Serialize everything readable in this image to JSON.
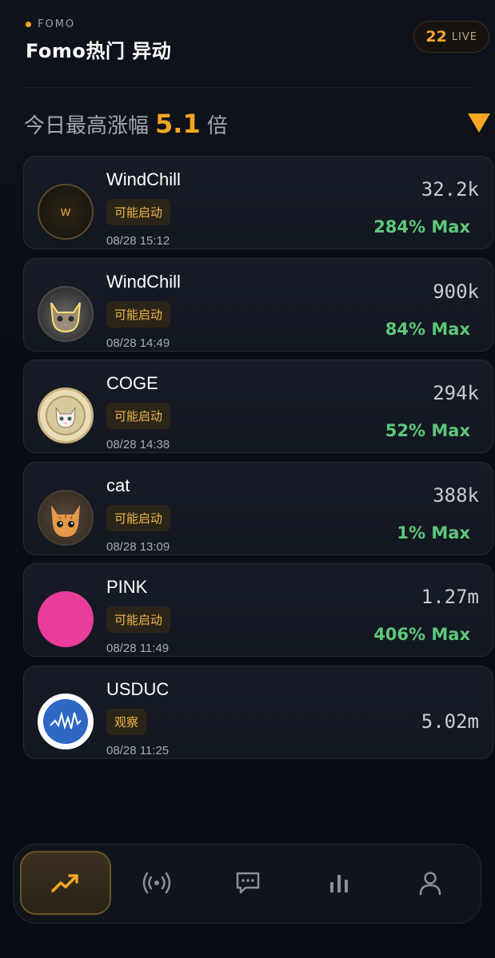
{
  "header": {
    "brand": "FOMO",
    "title": "Fomo热门 异动",
    "live_count": "22",
    "live_label": "LIVE"
  },
  "summary": {
    "prefix": "今日最高涨幅",
    "value": "5.1",
    "suffix": "倍"
  },
  "colors": {
    "accent": "#f5a623",
    "gain": "#5dc77a",
    "background": "#0b0e14",
    "card": "#151a23"
  },
  "tokens": [
    {
      "name": "WindChill",
      "tag": "可能启动",
      "time": "08/28 15:12",
      "value": "32.2k",
      "gain": "284% Max",
      "avatar_icon": "letter-w-coin-icon",
      "avatar_letter": "W"
    },
    {
      "name": "WindChill",
      "tag": "可能启动",
      "time": "08/28 14:49",
      "value": "900k",
      "gain": "84% Max",
      "avatar_icon": "glowing-cat-icon"
    },
    {
      "name": "COGE",
      "tag": "可能启动",
      "time": "08/28 14:38",
      "value": "294k",
      "gain": "52% Max",
      "avatar_icon": "cat-coin-icon"
    },
    {
      "name": "cat",
      "tag": "可能启动",
      "time": "08/28 13:09",
      "value": "388k",
      "gain": "1% Max",
      "avatar_icon": "orange-kitten-icon"
    },
    {
      "name": "PINK",
      "tag": "可能启动",
      "time": "08/28 11:49",
      "value": "1.27m",
      "gain": "406% Max",
      "avatar_icon": "pink-circle-icon"
    },
    {
      "name": "USDUC",
      "tag": "观察",
      "time": "08/28 11:25",
      "value": "5.02m",
      "gain": "",
      "avatar_icon": "waveform-logo-icon"
    }
  ],
  "nav": [
    {
      "name": "trending",
      "icon": "trending-up-icon",
      "active": true
    },
    {
      "name": "broadcast",
      "icon": "broadcast-icon",
      "active": false
    },
    {
      "name": "messages",
      "icon": "chat-bubble-icon",
      "active": false
    },
    {
      "name": "stats",
      "icon": "bar-chart-icon",
      "active": false
    },
    {
      "name": "profile",
      "icon": "user-icon",
      "active": false
    }
  ]
}
